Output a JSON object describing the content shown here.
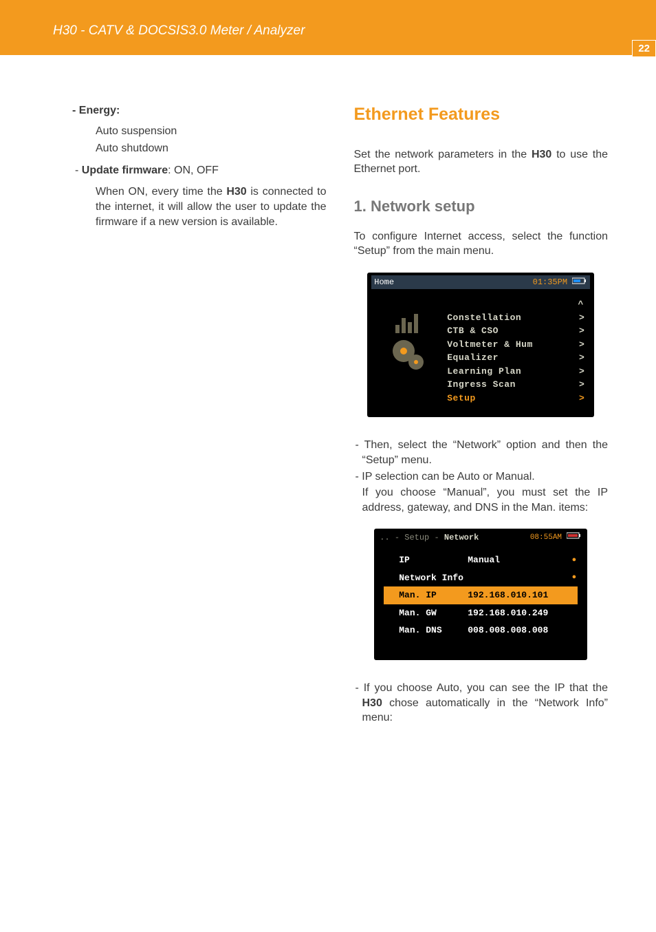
{
  "header": {
    "title": "H30 - CATV & DOCSIS3.0 Meter / Analyzer"
  },
  "page_number": "22",
  "left": {
    "energy_heading": "- Energy:",
    "energy_item1": "Auto suspension",
    "energy_item2": "Auto shutdown",
    "fw_prefix": "- ",
    "fw_bold": "Update firmware",
    "fw_suffix": ": ON, OFF",
    "fw_desc_a": "When ON, every time the ",
    "fw_desc_bold": "H30",
    "fw_desc_b": " is connected to the internet, it will allow the user to update the firmware if a new version is available."
  },
  "right": {
    "section_title": "Ethernet Features",
    "intro_a": "Set the network parameters in the ",
    "intro_bold": "H30",
    "intro_b": " to use the Ethernet port.",
    "sub_title": "1. Network setup",
    "p1": "To configure Internet access, select the function “Setup” from the main menu.",
    "screen1": {
      "home_label": "Home",
      "time": "01:35PM",
      "menu": [
        {
          "label": "Constellation",
          "color": "white"
        },
        {
          "label": "CTB & CSO",
          "color": "white"
        },
        {
          "label": "Voltmeter & Hum",
          "color": "white"
        },
        {
          "label": "Equalizer",
          "color": "white"
        },
        {
          "label": "Learning Plan",
          "color": "white"
        },
        {
          "label": "Ingress Scan",
          "color": "white"
        },
        {
          "label": "Setup",
          "color": "orange"
        }
      ],
      "arrow": ">",
      "caret_up": "^"
    },
    "b1": "- Then, select the “Network” option and then the “Setup” menu.",
    "b2": "- IP selection can be Auto or Manual.",
    "b2c": "If you choose “Manual”, you must set the IP address, gateway, and DNS in the Man. items:",
    "screen2": {
      "crumb_dim": ".. - Setup - ",
      "crumb_bold": "Network",
      "time": "08:55AM",
      "rows": [
        {
          "label": "IP",
          "value": "Manual",
          "dot": true,
          "highlight": false
        },
        {
          "label": "Network Info",
          "value": "",
          "dot": true,
          "highlight": false
        },
        {
          "label": "Man. IP",
          "value": "192.168.010.101",
          "dot": false,
          "highlight": true
        },
        {
          "label": "Man. GW",
          "value": "192.168.010.249",
          "dot": false,
          "highlight": false
        },
        {
          "label": "Man. DNS",
          "value": "008.008.008.008",
          "dot": false,
          "highlight": false
        }
      ]
    },
    "b3a": "- If you choose Auto, you can see the IP that the ",
    "b3bold": "H30",
    "b3b": " chose automatically in the  “Network Info” menu:"
  }
}
